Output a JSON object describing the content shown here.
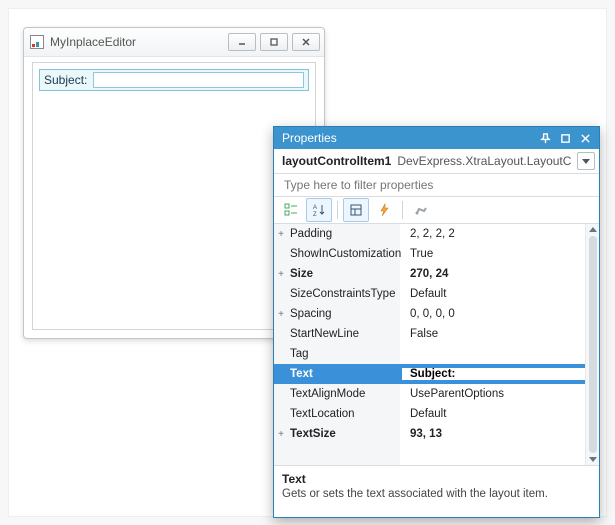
{
  "form": {
    "title": "MyInplaceEditor",
    "subject_label": "Subject:"
  },
  "properties": {
    "title": "Properties",
    "selected_name": "layoutControlItem1",
    "selected_type": "DevExpress.XtraLayout.LayoutC",
    "filter_placeholder": "Type here to filter properties",
    "rows": [
      {
        "expand": "+",
        "name": "Padding",
        "value": "2, 2, 2, 2",
        "bold": false
      },
      {
        "expand": "",
        "name": "ShowInCustomizationFo",
        "value": "True",
        "bold": false
      },
      {
        "expand": "+",
        "name": "Size",
        "value": "270, 24",
        "bold": true
      },
      {
        "expand": "",
        "name": "SizeConstraintsType",
        "value": "Default",
        "bold": false
      },
      {
        "expand": "+",
        "name": "Spacing",
        "value": "0, 0, 0, 0",
        "bold": false
      },
      {
        "expand": "",
        "name": "StartNewLine",
        "value": "False",
        "bold": false
      },
      {
        "expand": "",
        "name": "Tag",
        "value": "",
        "bold": false
      },
      {
        "expand": "",
        "name": "Text",
        "value": "Subject:",
        "bold": true,
        "selected": true
      },
      {
        "expand": "",
        "name": "TextAlignMode",
        "value": "UseParentOptions",
        "bold": false
      },
      {
        "expand": "",
        "name": "TextLocation",
        "value": "Default",
        "bold": false
      },
      {
        "expand": "+",
        "name": "TextSize",
        "value": "93, 13",
        "bold": true
      }
    ],
    "help_title": "Text",
    "help_text": "Gets or sets the text associated with the layout item."
  }
}
